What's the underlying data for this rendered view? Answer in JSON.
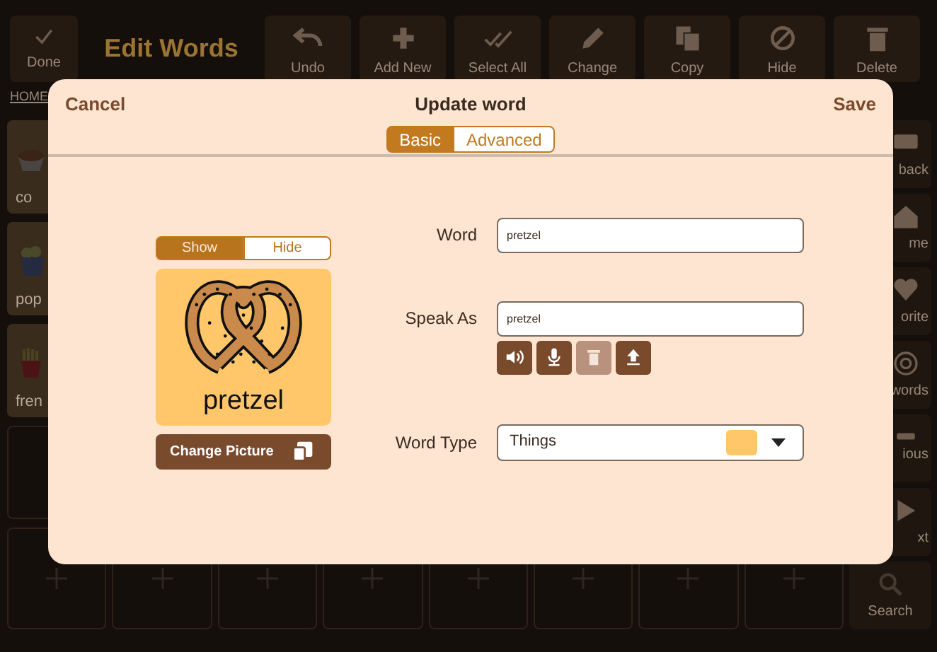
{
  "app": {
    "done": "Done",
    "title": "Edit Words",
    "actions": [
      {
        "label": "Undo",
        "kind": "undo"
      },
      {
        "label": "Add New",
        "kind": "add"
      },
      {
        "label": "Select All",
        "kind": "select"
      },
      {
        "label": "Change",
        "kind": "edit"
      },
      {
        "label": "Copy",
        "kind": "copy"
      },
      {
        "label": "Hide",
        "kind": "hide"
      },
      {
        "label": "Delete",
        "kind": "delete"
      }
    ],
    "breadcrumb": "HOME",
    "tiles": [
      {
        "label": "co",
        "kind": "cup"
      },
      {
        "label": "pop",
        "kind": "popcorn"
      },
      {
        "label": "fren",
        "kind": "fries"
      }
    ],
    "sidebar": [
      {
        "label": "back",
        "kind": "back"
      },
      {
        "label": "me",
        "kind": "home"
      },
      {
        "label": "orite",
        "kind": "heart"
      },
      {
        "label": "words",
        "kind": "target"
      },
      {
        "label": "ious",
        "kind": "prev"
      },
      {
        "label": "xt",
        "kind": "next"
      },
      {
        "label": "Search",
        "kind": "search"
      }
    ]
  },
  "dialog": {
    "cancel": "Cancel",
    "title": "Update word",
    "save": "Save",
    "tabs": [
      {
        "label": "Basic",
        "selected": true
      },
      {
        "label": "Advanced",
        "selected": false
      }
    ],
    "visibility": [
      {
        "label": "Show",
        "selected": true
      },
      {
        "label": "Hide",
        "selected": false
      }
    ],
    "card_label": "pretzel",
    "change_picture": "Change Picture",
    "word": {
      "label": "Word",
      "value": "pretzel"
    },
    "speak_as": {
      "label": "Speak As",
      "value": "pretzel"
    },
    "speak_buttons": [
      {
        "kind": "play",
        "disabled": false
      },
      {
        "kind": "record",
        "disabled": false
      },
      {
        "kind": "delete",
        "disabled": true
      },
      {
        "kind": "upload",
        "disabled": false
      }
    ],
    "word_type": {
      "label": "Word Type",
      "value": "Things",
      "color": "#ffc76a"
    }
  }
}
